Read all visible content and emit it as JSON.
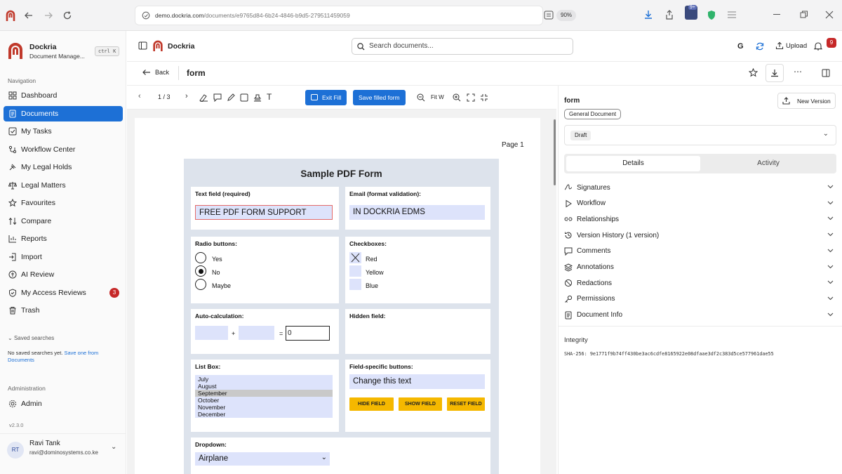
{
  "browser": {
    "url_host": "demo.dockria.com",
    "url_path": "/documents/e9765d84-6b24-4846-b9d5-279511459059",
    "zoom": "90%",
    "extension_badge": "9+"
  },
  "sidebar": {
    "app_name": "Dockria",
    "app_subtitle": "Document Manage...",
    "shortcut": "ctrl K",
    "nav_section": "Navigation",
    "items": [
      {
        "label": "Dashboard",
        "icon": "dashboard-icon"
      },
      {
        "label": "Documents",
        "icon": "document-icon",
        "active": true
      },
      {
        "label": "My Tasks",
        "icon": "tasks-icon"
      },
      {
        "label": "Workflow Center",
        "icon": "workflow-icon"
      },
      {
        "label": "My Legal Holds",
        "icon": "gavel-icon"
      },
      {
        "label": "Legal Matters",
        "icon": "scales-icon"
      },
      {
        "label": "Favourites",
        "icon": "star-icon"
      },
      {
        "label": "Compare",
        "icon": "compare-icon"
      },
      {
        "label": "Reports",
        "icon": "chart-icon"
      },
      {
        "label": "Import",
        "icon": "import-icon"
      },
      {
        "label": "AI Review",
        "icon": "ai-icon"
      },
      {
        "label": "My Access Reviews",
        "icon": "shield-check-icon",
        "badge": "3"
      },
      {
        "label": "Trash",
        "icon": "trash-icon"
      }
    ],
    "saved_searches_title": "Saved searches",
    "saved_searches_empty": "No saved searches yet.",
    "saved_searches_link": "Save one from Documents",
    "admin_section": "Administration",
    "admin_label": "Admin",
    "version": "v2.3.0",
    "user": {
      "initials": "RT",
      "name": "Ravi Tank",
      "email": "ravi@dominosystems.co.ke"
    }
  },
  "topbar": {
    "brand": "Dockria",
    "search_placeholder": "Search documents...",
    "upload_label": "Upload",
    "notification_count": "9"
  },
  "doc_header": {
    "back_label": "Back",
    "title": "form"
  },
  "viewer_toolbar": {
    "page_indicator": "1 / 3",
    "exit_fill_label": "Exit Fill",
    "save_filled_label": "Save filled form",
    "fit_label": "Fit W"
  },
  "pdf": {
    "page_label": "Page 1",
    "form_title": "Sample PDF Form",
    "text_field_label": "Text field (required)",
    "text_field_value": "FREE PDF FORM SUPPORT",
    "email_label": "Email (format validation):",
    "email_value": "IN DOCKRIA EDMS",
    "radio_label": "Radio buttons:",
    "radio_options": [
      "Yes",
      "No",
      "Maybe"
    ],
    "radio_selected": "No",
    "checkbox_label": "Checkboxes:",
    "checkbox_options": [
      {
        "label": "Red",
        "checked": true
      },
      {
        "label": "Yellow",
        "checked": false
      },
      {
        "label": "Blue",
        "checked": false
      }
    ],
    "autocalc_label": "Auto-calculation:",
    "autocalc_plus": "+",
    "autocalc_equals": "=",
    "autocalc_result": "0",
    "hidden_label": "Hidden field:",
    "listbox_label": "List Box:",
    "listbox_items": [
      "July",
      "August",
      "September",
      "October",
      "November",
      "December"
    ],
    "listbox_selected": "September",
    "field_buttons_label": "Field-specific buttons:",
    "change_text_value": "Change this text",
    "hide_field_label": "HIDE FIELD",
    "show_field_label": "SHOW FIELD",
    "reset_field_label": "RESET FIELD",
    "dropdown_label": "Dropdown:",
    "dropdown_value": "Airplane"
  },
  "right_panel": {
    "title": "form",
    "new_version_label": "New Version",
    "doc_type": "General Document",
    "status": "Draft",
    "tabs": [
      "Details",
      "Activity"
    ],
    "active_tab": "Details",
    "sections": [
      {
        "label": "Signatures",
        "icon": "signature-icon"
      },
      {
        "label": "Workflow",
        "icon": "play-icon"
      },
      {
        "label": "Relationships",
        "icon": "link-icon"
      },
      {
        "label": "Version History (1 version)",
        "icon": "history-icon"
      },
      {
        "label": "Comments",
        "icon": "comment-icon"
      },
      {
        "label": "Annotations",
        "icon": "layers-icon"
      },
      {
        "label": "Redactions",
        "icon": "redaction-icon"
      },
      {
        "label": "Permissions",
        "icon": "key-icon"
      },
      {
        "label": "Document Info",
        "icon": "info-doc-icon"
      }
    ],
    "integrity_label": "Integrity",
    "hash": "SHA-256: 9e1771f9b74ff430be3ac6cdfe8165922e08dfaae3df2c383d5ce577961dae55"
  },
  "colors": {
    "accent": "#1d70d6",
    "brand": "#c0392b",
    "badge": "#c62828",
    "form_button": "#f5b800"
  }
}
